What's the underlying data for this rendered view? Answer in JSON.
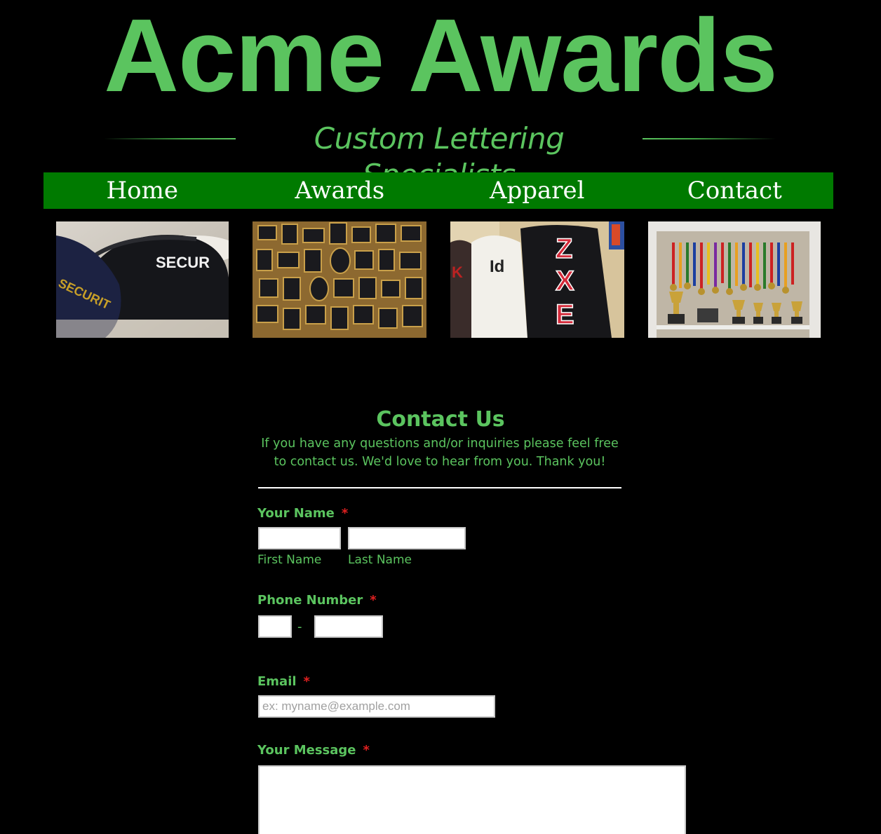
{
  "header": {
    "brand": "Acme Awards",
    "tagline": "Custom Lettering Specialists"
  },
  "nav": {
    "items": [
      {
        "label": "Home"
      },
      {
        "label": "Awards"
      },
      {
        "label": "Apparel"
      },
      {
        "label": "Contact"
      }
    ]
  },
  "gallery": {
    "images": [
      {
        "subject": "security caps",
        "caption_text": "SECUR"
      },
      {
        "subject": "plaques wall"
      },
      {
        "subject": "lettered jackets",
        "caption_text": "ZXE"
      },
      {
        "subject": "medals and trophies shelf"
      }
    ]
  },
  "form": {
    "title": "Contact Us",
    "description": "If you have any questions and/or inquiries please feel free to contact us. We'd love to hear from you. Thank you!",
    "required_mark": "*",
    "name": {
      "label": "Your Name",
      "first_label": "First Name",
      "last_label": "Last Name",
      "first_value": "",
      "last_value": ""
    },
    "phone": {
      "label": "Phone Number",
      "separator": "-",
      "area_value": "",
      "number_value": ""
    },
    "email": {
      "label": "Email",
      "placeholder": "ex: myname@example.com",
      "value": ""
    },
    "message": {
      "label": "Your Message",
      "value": ""
    }
  },
  "colors": {
    "background": "#000000",
    "brand_green": "#5bc45f",
    "nav_green": "#007a00",
    "required_red": "#e02020"
  }
}
